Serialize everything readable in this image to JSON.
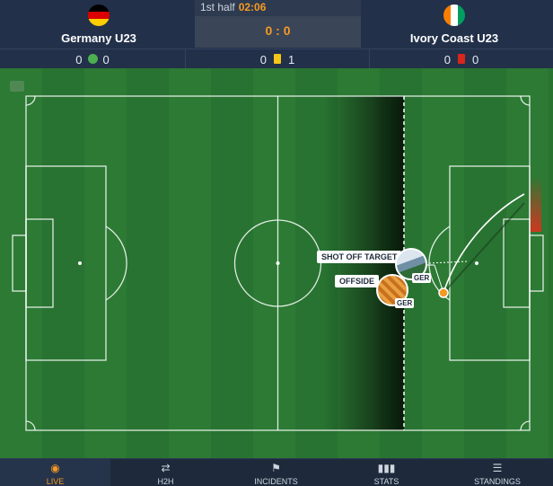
{
  "header": {
    "home": {
      "name": "Germany U23",
      "flag": "flag-germany"
    },
    "away": {
      "name": "Ivory Coast U23",
      "flag": "flag-ivory-coast"
    },
    "period": "1st half",
    "clock": "02:06",
    "score": "0 : 0"
  },
  "stats": {
    "substitutions": {
      "home": "0",
      "away": "0",
      "icon": "substitution-icon"
    },
    "yellow_cards": {
      "home": "0",
      "away": "1",
      "icon": "yellow-card-icon"
    },
    "red_cards": {
      "home": "0",
      "away": "0",
      "icon": "red-card-icon"
    }
  },
  "events": [
    {
      "label": "SHOT OFF TARGET",
      "team": "GER"
    },
    {
      "label": "OFFSIDE",
      "team": "GER"
    }
  ],
  "nav": [
    {
      "label": "LIVE",
      "icon": "eye-icon",
      "active": true
    },
    {
      "label": "H2H",
      "icon": "h2h-icon"
    },
    {
      "label": "INCIDENTS",
      "icon": "incidents-icon"
    },
    {
      "label": "STATS",
      "icon": "stats-icon"
    },
    {
      "label": "STANDINGS",
      "icon": "standings-icon"
    }
  ],
  "colors": {
    "accent": "#f59a23",
    "pitch": "#2c7a34",
    "header": "#22304a"
  }
}
